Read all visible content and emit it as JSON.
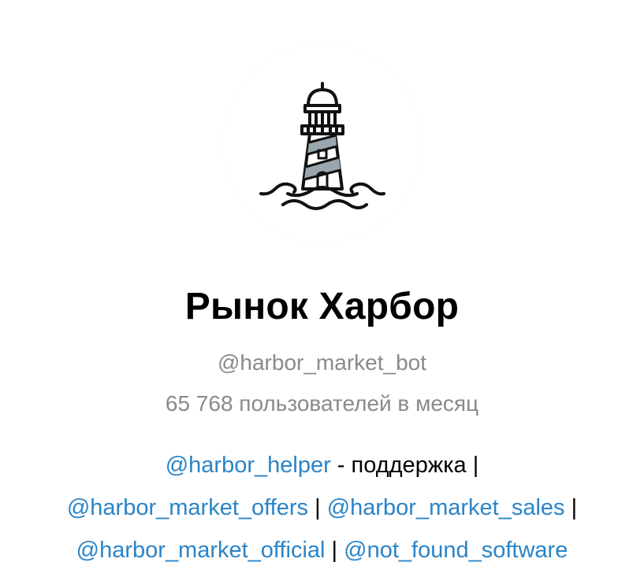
{
  "bot": {
    "name": "Рынок Харбор",
    "username": "@harbor_market_bot",
    "monthly_users": "65 768 пользователей в месяц",
    "avatar_icon": "lighthouse-icon"
  },
  "description": {
    "line1": {
      "link": "@harbor_helper",
      "text": " - поддержка |"
    },
    "line2": {
      "link1": "@harbor_market_offers",
      "sep1": " | ",
      "link2": "@harbor_market_sales",
      "sep2": " |"
    },
    "line3": {
      "link1": "@harbor_market_official",
      "sep1": " | ",
      "link2": "@not_found_software"
    }
  },
  "colors": {
    "link": "#2a84c8",
    "muted": "#8a8a8a",
    "text": "#000000"
  }
}
